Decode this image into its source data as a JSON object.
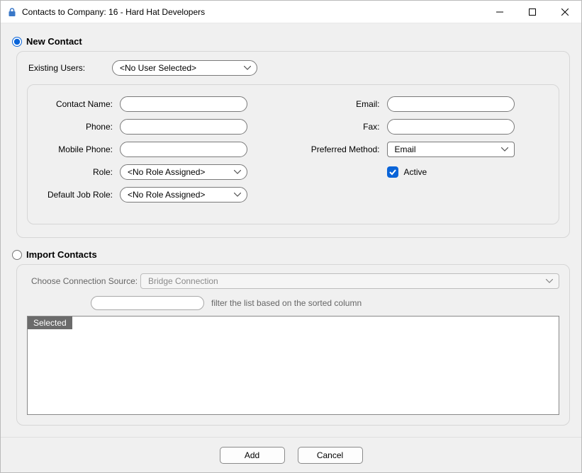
{
  "window": {
    "title": "Contacts to Company: 16 - Hard Hat Developers"
  },
  "mode": {
    "new_contact_label": "New Contact",
    "import_label": "Import Contacts",
    "selected": "new"
  },
  "new_contact": {
    "existing_users_label": "Existing Users:",
    "existing_users_value": "<No User Selected>",
    "fields": {
      "contact_name_label": "Contact Name:",
      "contact_name_value": "",
      "phone_label": "Phone:",
      "phone_value": "",
      "mobile_label": "Mobile Phone:",
      "mobile_value": "",
      "role_label": "Role:",
      "role_value": "<No Role Assigned>",
      "default_job_role_label": "Default Job Role:",
      "default_job_role_value": "<No Role Assigned>",
      "email_label": "Email:",
      "email_value": "",
      "fax_label": "Fax:",
      "fax_value": "",
      "preferred_label": "Preferred Method:",
      "preferred_value": "Email",
      "active_label": "Active",
      "active_checked": true
    }
  },
  "import": {
    "source_label": "Choose Connection Source:",
    "source_value": "Bridge Connection",
    "filter_hint": "filter the list based on the sorted column",
    "grid": {
      "columns": [
        "Selected"
      ],
      "rows": []
    }
  },
  "footer": {
    "add": "Add",
    "cancel": "Cancel"
  }
}
